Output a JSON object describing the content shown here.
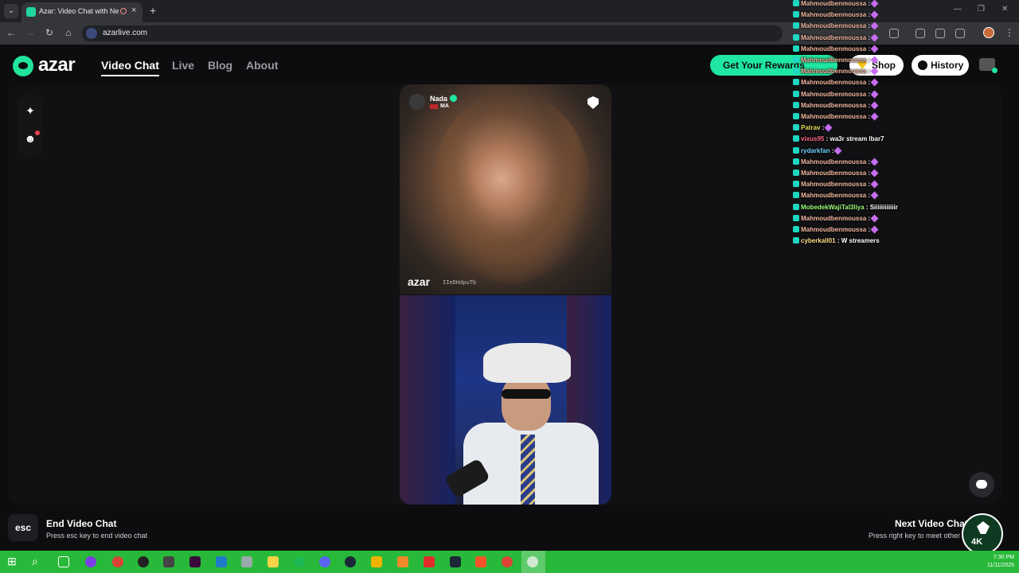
{
  "browser": {
    "tab_title": "Azar: Video Chat with New",
    "close_glyph": "×",
    "new_tab_glyph": "+",
    "url": "azarlive.com",
    "window_controls": [
      "—",
      "❐",
      "✕"
    ]
  },
  "header": {
    "logo": "azar",
    "nav": [
      {
        "label": "Video Chat",
        "active": true
      },
      {
        "label": "Live",
        "active": false
      },
      {
        "label": "Blog",
        "active": false
      },
      {
        "label": "About",
        "active": false
      }
    ],
    "rewards_label": "Get Your Rewards",
    "shop_label": "Shop",
    "history_label": "History"
  },
  "side_tools": [
    {
      "icon": "sparkle-icon",
      "glyph": "✦"
    },
    {
      "icon": "face-filter-icon",
      "glyph": "☻"
    }
  ],
  "peer": {
    "name": "Nada",
    "country": "MA",
    "watermark": "azar",
    "watermark_id": "IIeDHdpuTb"
  },
  "footer": {
    "esc_key": "esc",
    "end_title": "End Video Chat",
    "end_sub": "Press esc key to end video chat",
    "next_title": "Next Video Chat",
    "next_sub": "Press right key to meet other"
  },
  "stream_badge": "4K",
  "stream_chat": [
    {
      "user": "Mahmoudbenmoussa",
      "msg": ":",
      "style": "mahmoud",
      "emote": true
    },
    {
      "user": "Mahmoudbenmoussa",
      "msg": ":",
      "style": "mahmoud",
      "emote": true
    },
    {
      "user": "Mahmoudbenmoussa",
      "msg": ":",
      "style": "mahmoud",
      "emote": true
    },
    {
      "user": "Mahmoudbenmoussa",
      "msg": ":",
      "style": "mahmoud",
      "emote": true
    },
    {
      "user": "Mahmoudbenmoussa",
      "msg": ":",
      "style": "mahmoud",
      "emote": true
    },
    {
      "user": "Mahmoudbenmoussa",
      "msg": ":",
      "style": "mahmoud",
      "emote": true
    },
    {
      "user": "Mahmoudbenmoussa",
      "msg": ":",
      "style": "mahmoud",
      "emote": true
    },
    {
      "user": "Mahmoudbenmoussa",
      "msg": ":",
      "style": "mahmoud",
      "emote": true
    },
    {
      "user": "Mahmoudbenmoussa",
      "msg": ":",
      "style": "mahmoud",
      "emote": true
    },
    {
      "user": "Mahmoudbenmoussa",
      "msg": ":",
      "style": "mahmoud",
      "emote": true
    },
    {
      "user": "Mahmoudbenmoussa",
      "msg": ":",
      "style": "mahmoud",
      "emote": true
    },
    {
      "user": "Patrav",
      "msg": ":",
      "style": "patrav",
      "emote": true
    },
    {
      "user": "vixus95",
      "msg": ": wa3r stream lbar7",
      "style": "vixus",
      "emote": false
    },
    {
      "user": "rydarkfan",
      "msg": ":",
      "style": "rydark",
      "emote": true
    },
    {
      "user": "Mahmoudbenmoussa",
      "msg": ":",
      "style": "mahmoud",
      "emote": true
    },
    {
      "user": "Mahmoudbenmoussa",
      "msg": ":",
      "style": "mahmoud",
      "emote": true
    },
    {
      "user": "Mahmoudbenmoussa",
      "msg": ":",
      "style": "mahmoud",
      "emote": true
    },
    {
      "user": "Mahmoudbenmoussa",
      "msg": ":",
      "style": "mahmoud",
      "emote": true
    },
    {
      "user": "MobedekWajiTal3liya",
      "msg": ": Siiiiiiiiiiiir",
      "style": "mobedek",
      "emote": false
    },
    {
      "user": "Mahmoudbenmoussa",
      "msg": ":",
      "style": "mahmoud",
      "emote": true
    },
    {
      "user": "Mahmoudbenmoussa",
      "msg": ":",
      "style": "mahmoud",
      "emote": true
    },
    {
      "user": "cyberkall01",
      "msg": ": W streamers",
      "style": "cyber",
      "emote": false
    }
  ],
  "taskbar": {
    "time": "7:30 PM",
    "date": "11/11/2025",
    "start_glyph": "⊞",
    "search_glyph": "⌕"
  }
}
